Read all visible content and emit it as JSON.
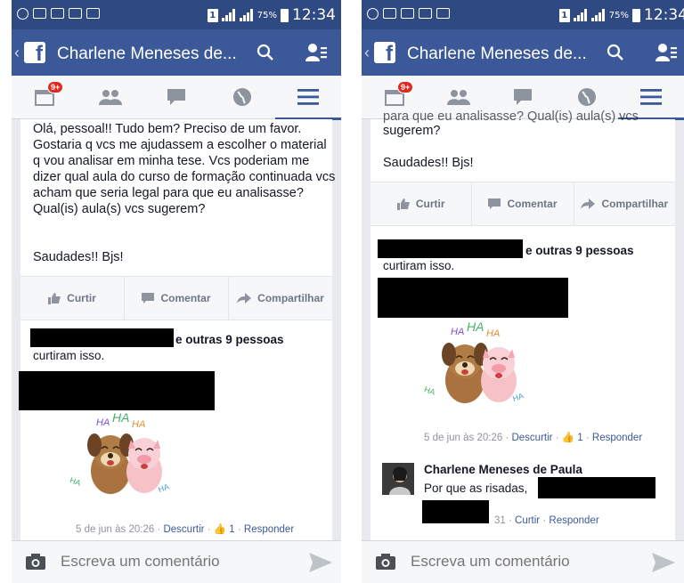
{
  "status": {
    "battery": "75%",
    "time": "12:34",
    "sim": "1"
  },
  "header": {
    "title": "Charlene Meneses de...",
    "badge": "9+"
  },
  "post": {
    "text_full": "Olá, pessoal!! Tudo bem? Preciso de um favor. Gostaria q vcs me ajudassem a escolher o material q vou analisar em minha tese. Vcs poderiam me dizer qual aula do curso de formação continuada vcs acham que seria legal para que eu analisasse? Qual(is) aula(s) vcs sugerem?",
    "text_partial_top": "para que eu analisasse? Qual(is) aula(s) vcs",
    "text_partial": "sugerem?",
    "signoff": "Saudades!! Bjs!"
  },
  "actions": {
    "like": "Curtir",
    "comment": "Comentar",
    "share": "Compartilhar"
  },
  "likes": {
    "suffix": "e outras 9 pessoas",
    "line2": "curtiram isso."
  },
  "comment1": {
    "sticker_text": "HA HA HA",
    "date": "5 de jun às 20:26",
    "unlike": "Descurtir",
    "count": "1",
    "reply": "Responder"
  },
  "comment2": {
    "name": "Charlene Meneses de Paula",
    "text": "Por que as risadas,",
    "time_fragment": "31",
    "like": "Curtir",
    "reply": "Responder"
  },
  "composer": {
    "placeholder": "Escreva um comentário"
  },
  "colors": {
    "brand": "#3b5998",
    "statusbar": "#2f4a82",
    "badge": "#e02a20"
  }
}
